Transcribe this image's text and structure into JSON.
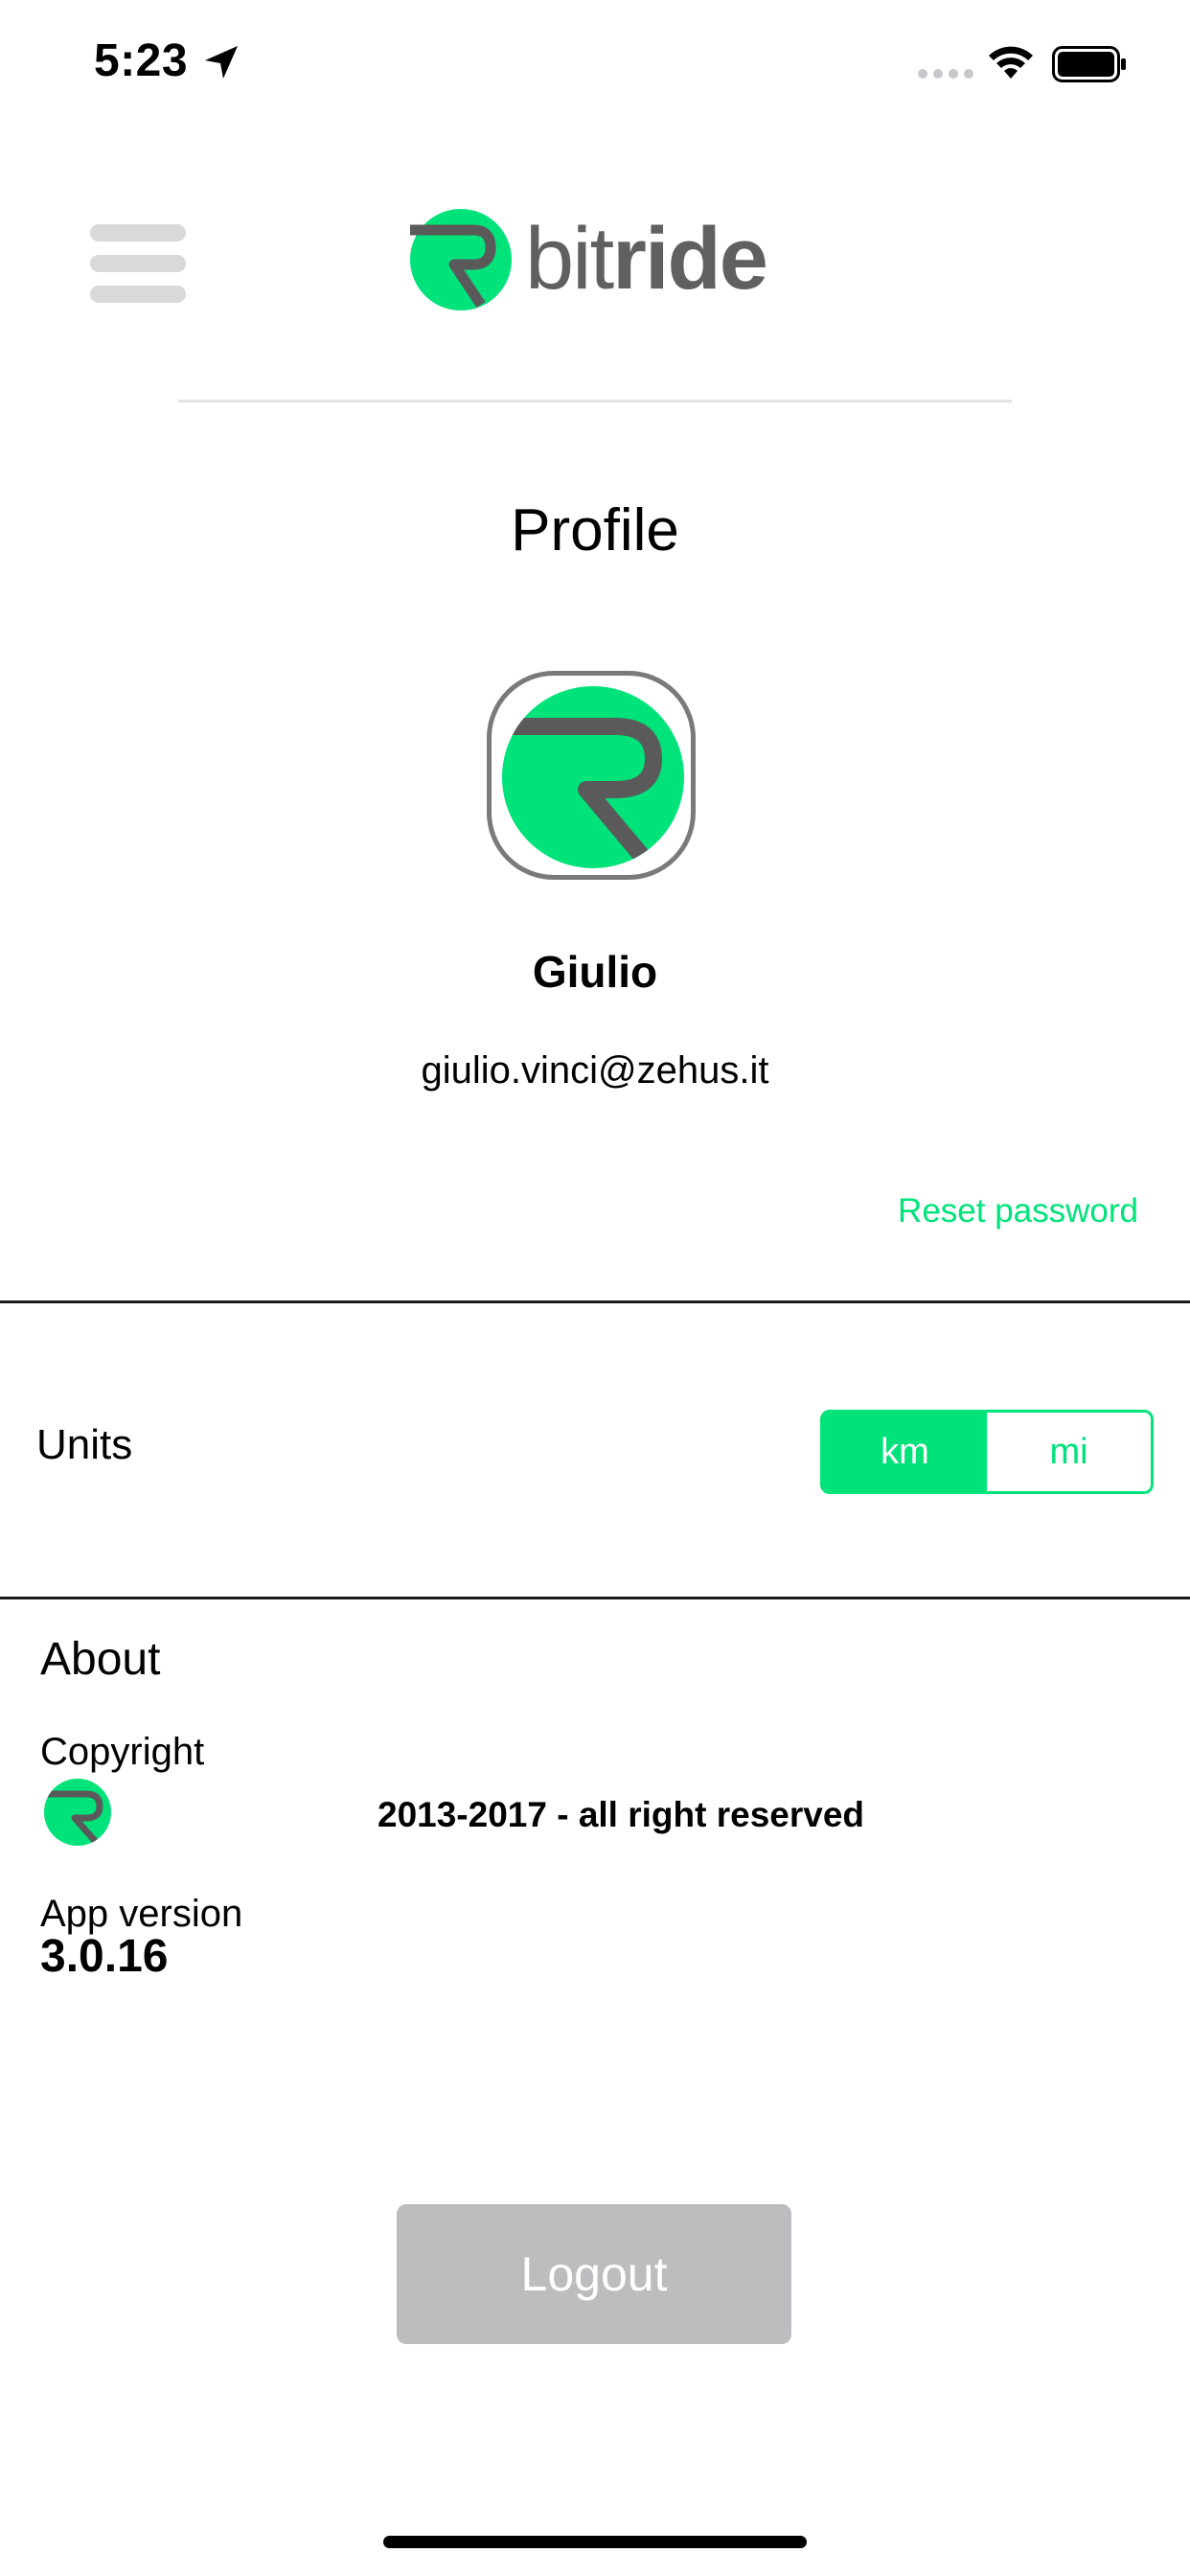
{
  "status_bar": {
    "time": "5:23",
    "icons": [
      "location-arrow-icon",
      "cellular-dots-icon",
      "wifi-icon",
      "battery-icon"
    ]
  },
  "header": {
    "menu_icon": "hamburger-menu-icon",
    "logo": {
      "text_light": "bit",
      "text_bold": "ride"
    }
  },
  "profile": {
    "title": "Profile",
    "name": "Giulio",
    "email": "giulio.vinci@zehus.it",
    "reset_password": "Reset password"
  },
  "units": {
    "label": "Units",
    "options": [
      "km",
      "mi"
    ],
    "selected": "km"
  },
  "about": {
    "title": "About",
    "copyright_label": "Copyright",
    "copyright_text": "2013-2017 - all right reserved",
    "version_label": "App version",
    "version_value": "3.0.16"
  },
  "actions": {
    "logout": "Logout"
  },
  "colors": {
    "accent": "#00e37a",
    "logo_grey": "#606060",
    "button_disabled": "#bdbdbf"
  }
}
